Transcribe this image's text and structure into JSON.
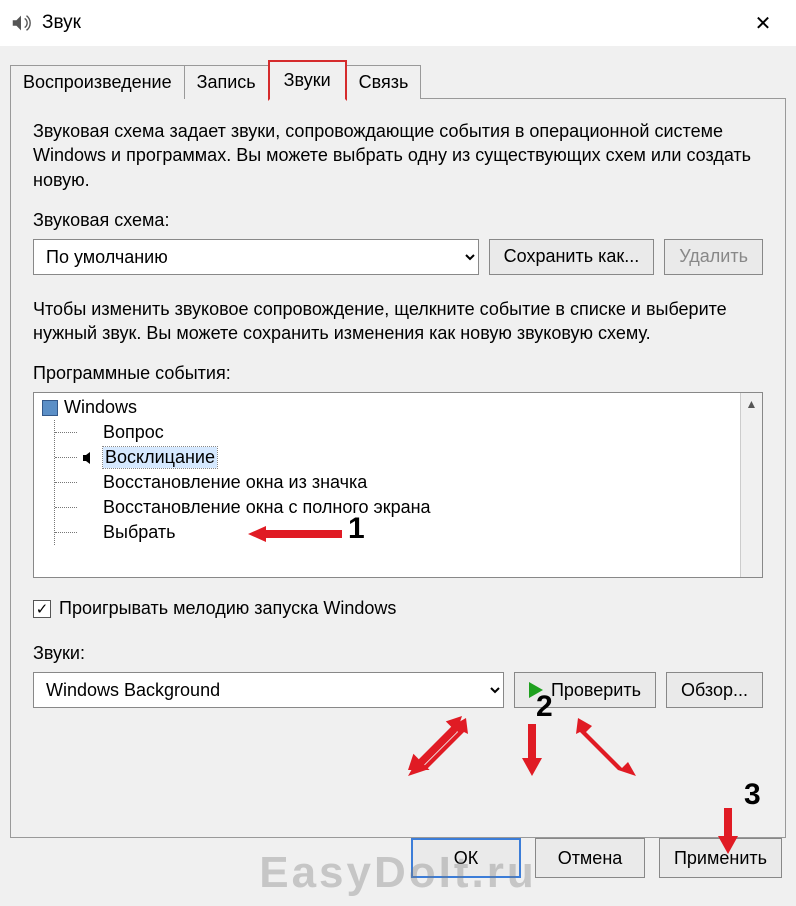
{
  "window": {
    "title": "Звук",
    "close_glyph": "✕"
  },
  "tabs": {
    "playback": "Воспроизведение",
    "recording": "Запись",
    "sounds": "Звуки",
    "communications": "Связь"
  },
  "description": "Звуковая схема задает звуки, сопровождающие события в операционной системе Windows и программах. Вы можете выбрать одну из существующих схем или создать новую.",
  "scheme": {
    "label": "Звуковая схема:",
    "selected": "По умолчанию",
    "save_as": "Сохранить как...",
    "delete": "Удалить"
  },
  "events_desc": "Чтобы изменить звуковое сопровождение, щелкните событие в списке и выберите нужный звук. Вы можете сохранить изменения как новую звуковую схему.",
  "events": {
    "label": "Программные события:",
    "root": "Windows",
    "items": [
      {
        "text": "Вопрос",
        "hasSound": false,
        "selected": false
      },
      {
        "text": "Восклицание",
        "hasSound": true,
        "selected": true
      },
      {
        "text": "Восстановление окна из значка",
        "hasSound": false,
        "selected": false
      },
      {
        "text": "Восстановление окна с полного экрана",
        "hasSound": false,
        "selected": false
      },
      {
        "text": "Выбрать",
        "hasSound": false,
        "selected": false
      }
    ]
  },
  "startup_checkbox": {
    "label": "Проигрывать мелодию запуска Windows",
    "checked": true
  },
  "sounds": {
    "label": "Звуки:",
    "selected": "Windows Background",
    "test": "Проверить",
    "browse": "Обзор..."
  },
  "buttons": {
    "ok": "ОК",
    "cancel": "Отмена",
    "apply": "Применить"
  },
  "annotations": {
    "n1": "1",
    "n2": "2",
    "n3": "3"
  },
  "watermark": "EasyDoIt.ru"
}
